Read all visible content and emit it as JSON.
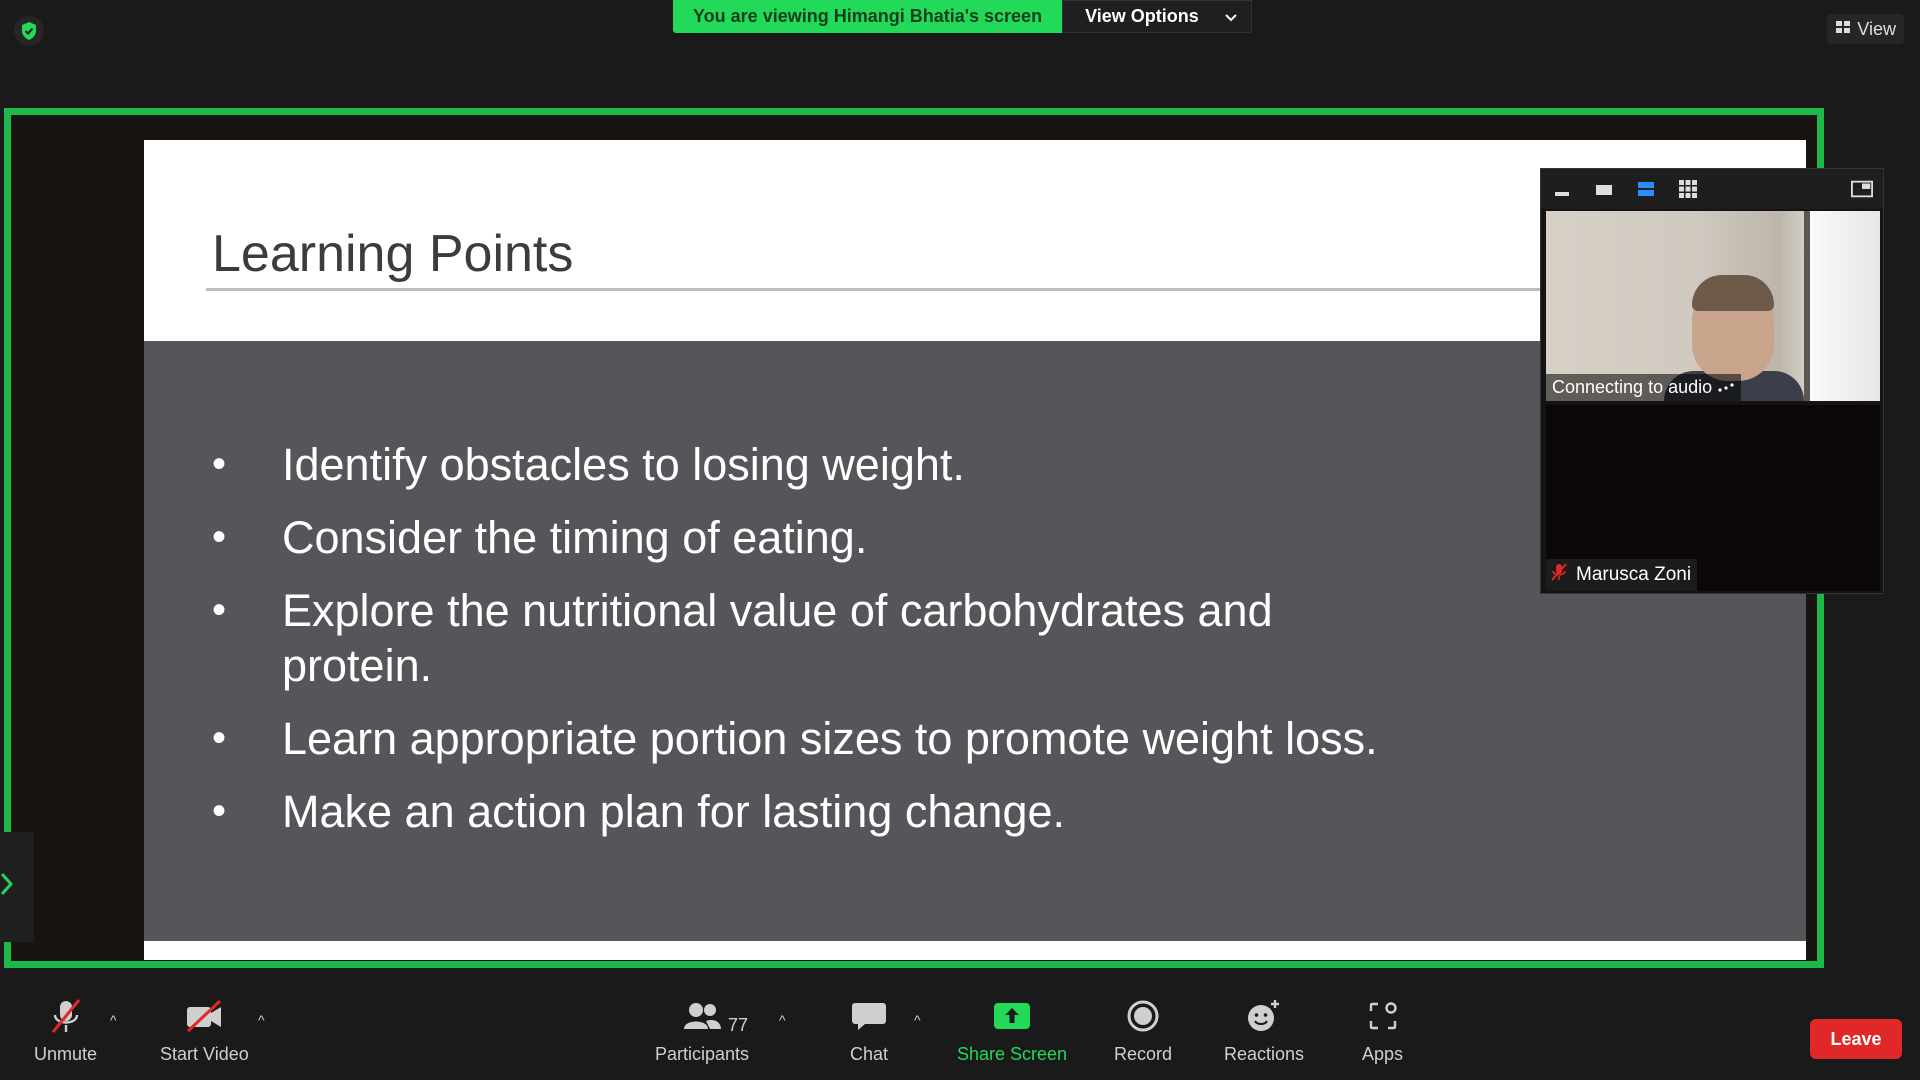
{
  "banner": {
    "viewing_text": "You are viewing Himangi Bhatia's screen",
    "view_options": "View Options"
  },
  "top_right": {
    "view_label": "View"
  },
  "slide": {
    "title": "Learning Points",
    "bullets": [
      "Identify obstacles to losing weight.",
      "Consider the timing of eating.",
      "Explore the nutritional value of carbohydrates and protein.",
      "Learn appropriate portion sizes to promote weight loss.",
      "Make an action plan for lasting change."
    ]
  },
  "video_panel": {
    "tile1_status": "Connecting to audio",
    "tile2_name": "Marusca Zoni"
  },
  "toolbar": {
    "unmute": "Unmute",
    "start_video": "Start Video",
    "participants": "Participants",
    "participants_count": "77",
    "chat": "Chat",
    "share_screen": "Share Screen",
    "record": "Record",
    "reactions": "Reactions",
    "apps": "Apps",
    "leave": "Leave"
  },
  "colors": {
    "accent_green": "#23d959",
    "share_border": "#1cb84a",
    "leave_red": "#e02828"
  }
}
